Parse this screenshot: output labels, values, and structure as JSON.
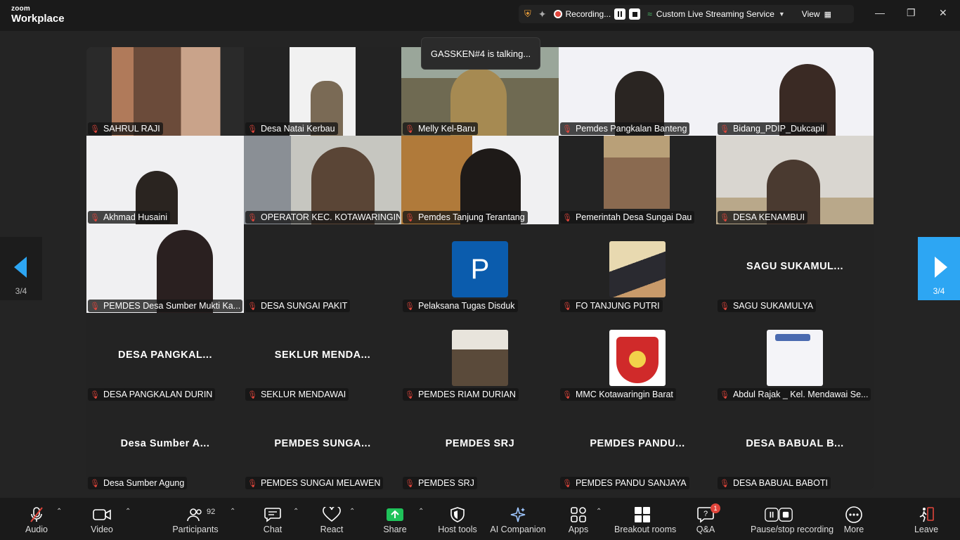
{
  "app": {
    "brand_top": "zoom",
    "brand_bottom": "Workplace"
  },
  "recording": {
    "label": "Recording...",
    "stream_label": "Custom Live Streaming Service",
    "view_label": "View"
  },
  "talking": "GASSKEN#4 is talking...",
  "pager": {
    "left": "3/4",
    "right": "3/4"
  },
  "tiles": [
    {
      "name": "SAHRUL RAJI",
      "big": ""
    },
    {
      "name": "Desa Natai Kerbau",
      "big": ""
    },
    {
      "name": "Melly Kel-Baru",
      "big": ""
    },
    {
      "name": "Pemdes Pangkalan Banteng",
      "big": ""
    },
    {
      "name": "Bidang_PDIP_Dukcapil",
      "big": ""
    },
    {
      "name": "Akhmad Husaini",
      "big": ""
    },
    {
      "name": "OPERATOR KEC. KOTAWARINGIN...",
      "big": ""
    },
    {
      "name": "Pemdes Tanjung Terantang",
      "big": ""
    },
    {
      "name": "Pemerintah Desa Sungai Dau",
      "big": ""
    },
    {
      "name": "DESA KENAMBUI",
      "big": ""
    },
    {
      "name": "PEMDES Desa Sumber Mukti Ka...",
      "big": ""
    },
    {
      "name": "DESA SUNGAI PAKIT",
      "big": ""
    },
    {
      "name": "Pelaksana Tugas Disduk",
      "big": "",
      "avatar_letter": "P"
    },
    {
      "name": "FO TANJUNG PUTRI",
      "big": ""
    },
    {
      "name": "SAGU SUKAMULYA",
      "big": "SAGU SUKAMUL..."
    },
    {
      "name": "DESA PANGKALAN DURIN",
      "big": "DESA PANGKAL..."
    },
    {
      "name": "SEKLUR MENDAWAI",
      "big": "SEKLUR MENDA..."
    },
    {
      "name": "PEMDES RIAM DURIAN",
      "big": ""
    },
    {
      "name": "MMC Kotawaringin Barat",
      "big": ""
    },
    {
      "name": "Abdul Rajak _ Kel. Mendawai Se...",
      "big": ""
    },
    {
      "name": "Desa Sumber Agung",
      "big": "Desa Sumber A..."
    },
    {
      "name": "PEMDES SUNGAI MELAWEN",
      "big": "PEMDES SUNGA..."
    },
    {
      "name": "PEMDES SRJ",
      "big": "PEMDES SRJ"
    },
    {
      "name": "PEMDES PANDU SANJAYA",
      "big": "PEMDES PANDU..."
    },
    {
      "name": "DESA BABUAL BABOTI",
      "big": "DESA BABUAL B..."
    }
  ],
  "toolbar": {
    "audio": "Audio",
    "video": "Video",
    "participants": "Participants",
    "participants_count": "92",
    "chat": "Chat",
    "react": "React",
    "share": "Share",
    "host_tools": "Host tools",
    "ai_companion": "AI Companion",
    "apps": "Apps",
    "breakout": "Breakout rooms",
    "qa": "Q&A",
    "qa_badge": "1",
    "pause_rec": "Pause/stop recording",
    "more": "More",
    "leave": "Leave"
  }
}
